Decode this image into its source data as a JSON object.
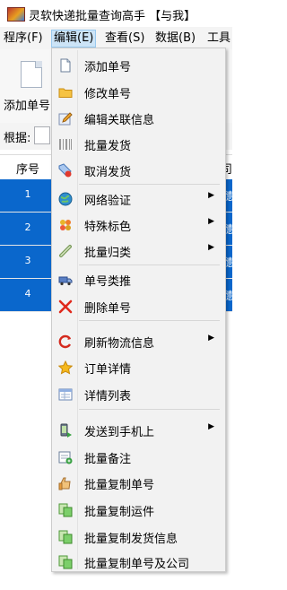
{
  "window": {
    "title": "灵软快递批量查询高手 【与我】"
  },
  "menubar": [
    {
      "label": "程序(F)"
    },
    {
      "label": "编辑(E)"
    },
    {
      "label": "查看(S)"
    },
    {
      "label": "数据(B)"
    },
    {
      "label": "工具"
    }
  ],
  "toolbar": {
    "add_label": "添加单号"
  },
  "filter": {
    "label": "根据:"
  },
  "grid": {
    "headers": {
      "seq": "序号",
      "right": "司"
    },
    "rows": [
      {
        "num": "1",
        "right": "德"
      },
      {
        "num": "2",
        "right": "德"
      },
      {
        "num": "3",
        "right": "德"
      },
      {
        "num": "4",
        "right": "德"
      }
    ]
  },
  "edit_menu": {
    "items": [
      {
        "label": "添加单号",
        "icon": "page-icon"
      },
      {
        "label": "修改单号",
        "icon": "folder-icon"
      },
      {
        "label": "编辑关联信息",
        "icon": "edit-icon"
      },
      {
        "label": "批量发货",
        "icon": "barcode-icon"
      },
      {
        "label": "取消发货",
        "icon": "tag-cancel-icon"
      },
      {
        "label": "网络验证",
        "icon": "globe-icon",
        "submenu": true
      },
      {
        "label": "特殊标色",
        "icon": "color-star-icon",
        "submenu": true
      },
      {
        "label": "批量归类",
        "icon": "link-icon",
        "submenu": true
      },
      {
        "label": "单号类推",
        "icon": "truck-icon"
      },
      {
        "label": "删除单号",
        "icon": "delete-x-icon"
      },
      {
        "label": "刷新物流信息",
        "icon": "refresh-icon",
        "submenu": true
      },
      {
        "label": "订单详情",
        "icon": "star-icon"
      },
      {
        "label": "详情列表",
        "icon": "list-icon"
      },
      {
        "label": "发送到手机上",
        "icon": "phone-send-icon",
        "submenu": true
      },
      {
        "label": "批量备注",
        "icon": "note-icon"
      },
      {
        "label": "批量复制单号",
        "icon": "hand-copy-icon"
      },
      {
        "label": "批量复制运件",
        "icon": "copy-icon"
      },
      {
        "label": "批量复制发货信息",
        "icon": "copy-icon"
      },
      {
        "label": "批量复制单号及公司",
        "icon": "copy-icon"
      }
    ]
  },
  "colors": {
    "selection": "#0a67cc",
    "menu_bg": "#f2f2f2",
    "menu_hover": "#cce4f7"
  }
}
